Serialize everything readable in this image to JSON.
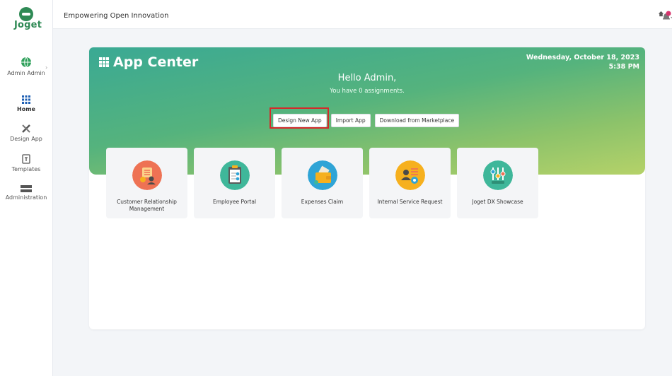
{
  "brand": {
    "logo_text": "Joget"
  },
  "sidebar": {
    "user": {
      "label": "Admin Admin"
    },
    "items": [
      {
        "label": "Home",
        "icon": "grid-icon"
      },
      {
        "label": "Design App",
        "icon": "tools-icon"
      },
      {
        "label": "Templates",
        "icon": "template-icon"
      },
      {
        "label": "Administration",
        "icon": "server-icon"
      }
    ]
  },
  "topbar": {
    "title": "Empowering Open Innovation"
  },
  "hero": {
    "title": "App Center",
    "date": "Wednesday, October 18, 2023",
    "time": "5:38 PM",
    "greeting": "Hello Admin,",
    "assignments": "You have 0 assignments."
  },
  "actions": {
    "design_new_app": "Design New App",
    "import_app": "Import App",
    "download_marketplace": "Download from Marketplace"
  },
  "apps": [
    {
      "label": "Customer Relationship Management",
      "color": "#ee7254",
      "icon": "crm-icon"
    },
    {
      "label": "Employee Portal",
      "color": "#3fb79a",
      "icon": "clipboard-icon"
    },
    {
      "label": "Expenses Claim",
      "color": "#2fa4d6",
      "icon": "wallet-icon"
    },
    {
      "label": "Internal Service Request",
      "color": "#f6b01e",
      "icon": "service-icon"
    },
    {
      "label": "Joget DX Showcase",
      "color": "#3fb79a",
      "icon": "showcase-icon"
    }
  ],
  "notifications": {
    "count": "0"
  }
}
